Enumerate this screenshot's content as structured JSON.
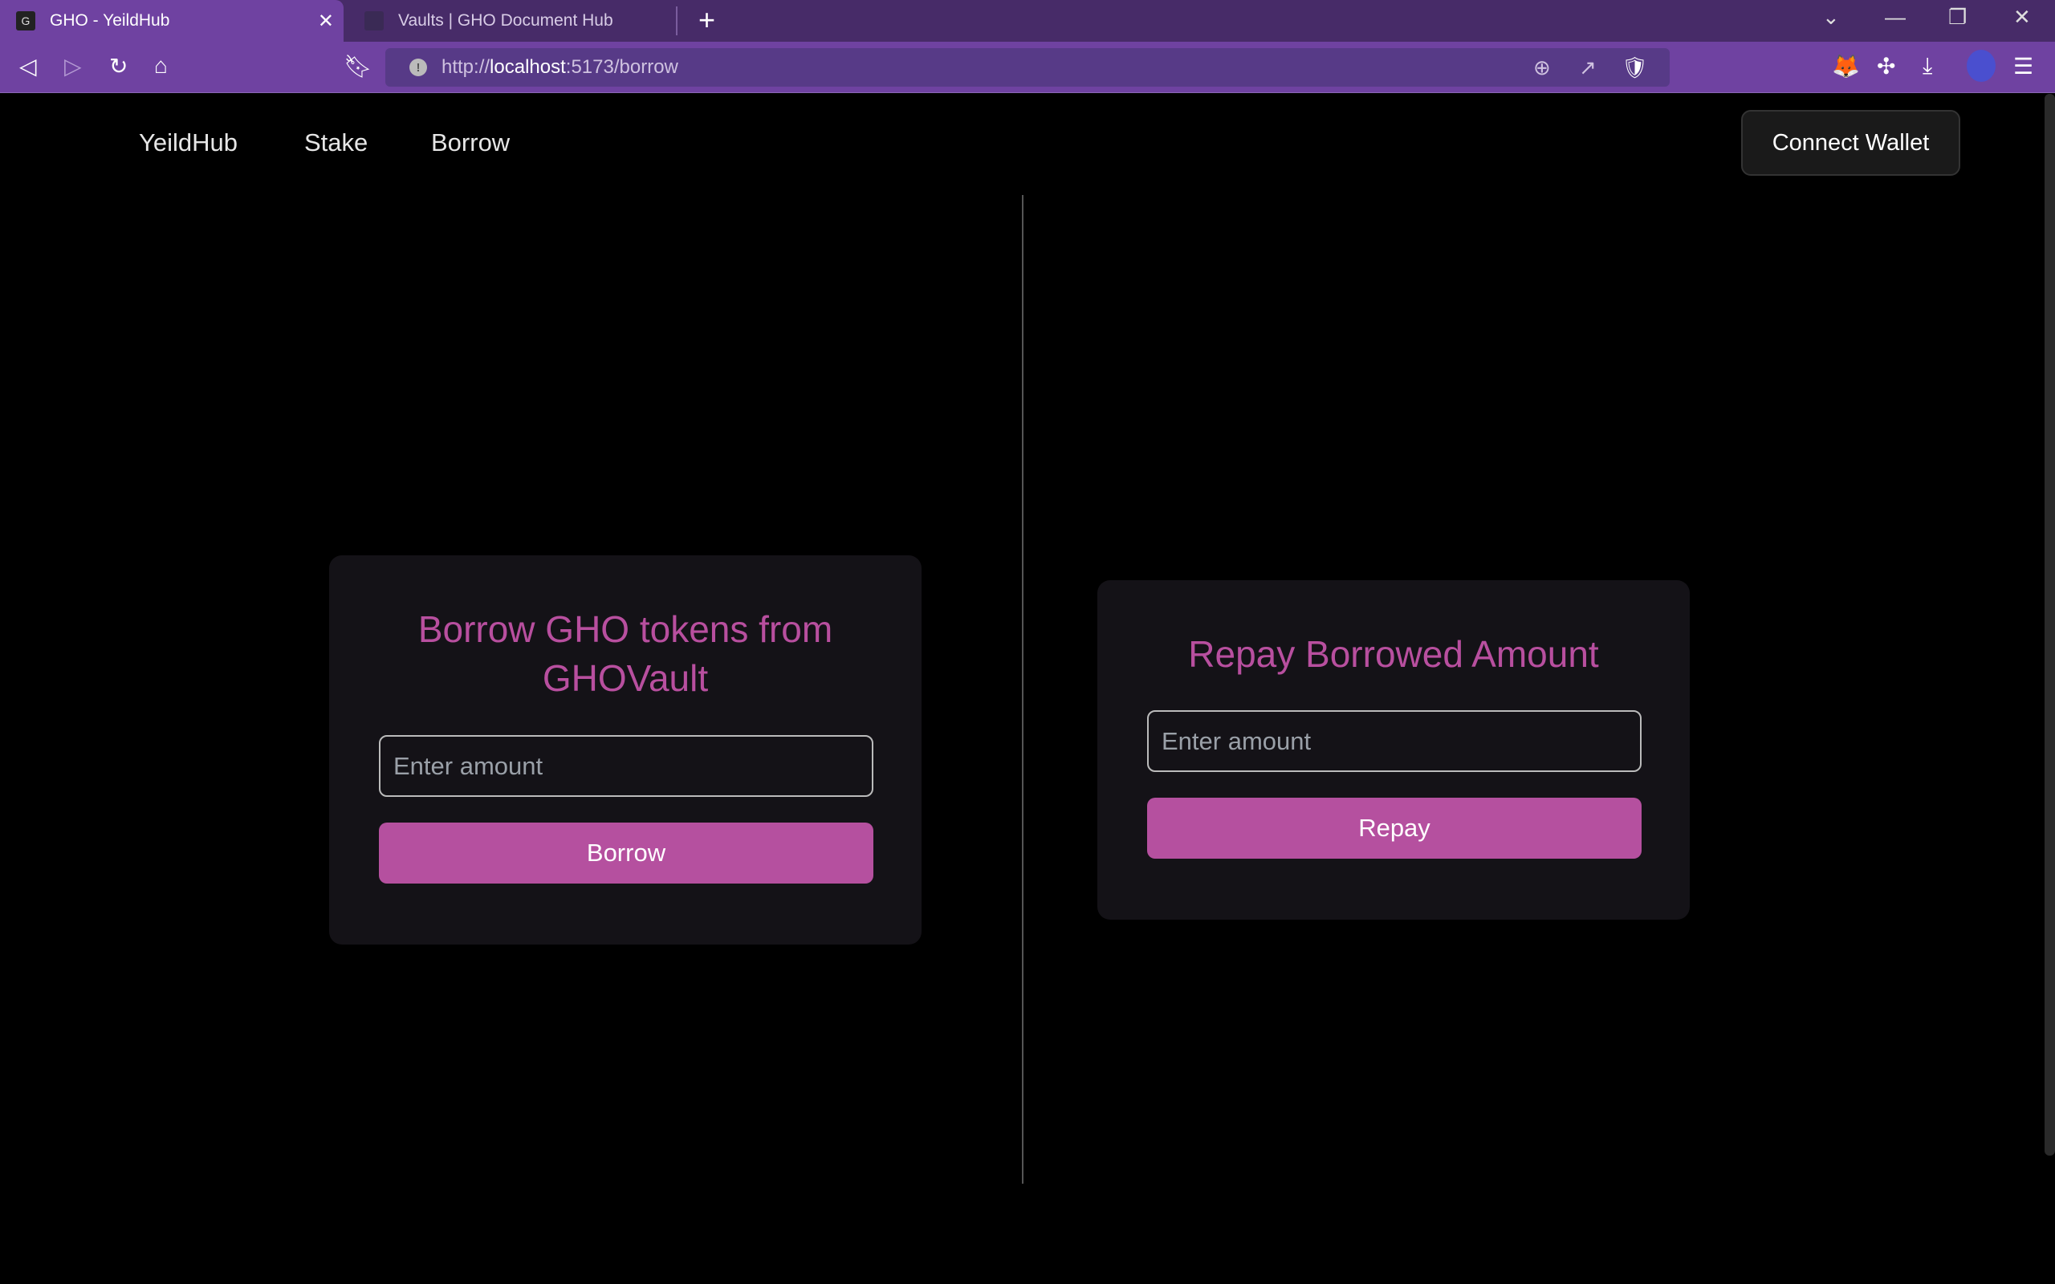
{
  "browser": {
    "tabs": [
      {
        "title": "GHO - YeildHub",
        "active": true
      },
      {
        "title": "Vaults | GHO Document Hub",
        "active": false
      }
    ],
    "url_prefix": "http://",
    "url_host": "localhost",
    "url_rest": ":5173/borrow"
  },
  "nav": {
    "brand": "YeildHub",
    "items": [
      "Stake",
      "Borrow"
    ],
    "connect_label": "Connect Wallet"
  },
  "borrow_card": {
    "title": "Borrow GHO tokens from GHOVault",
    "placeholder": "Enter amount",
    "button": "Borrow"
  },
  "repay_card": {
    "title": "Repay Borrowed Amount",
    "placeholder": "Enter amount",
    "button": "Repay"
  },
  "colors": {
    "accent": "#b5509f",
    "title": "#b84f9f",
    "card": "#141217",
    "chrome": "#6f42a1"
  }
}
